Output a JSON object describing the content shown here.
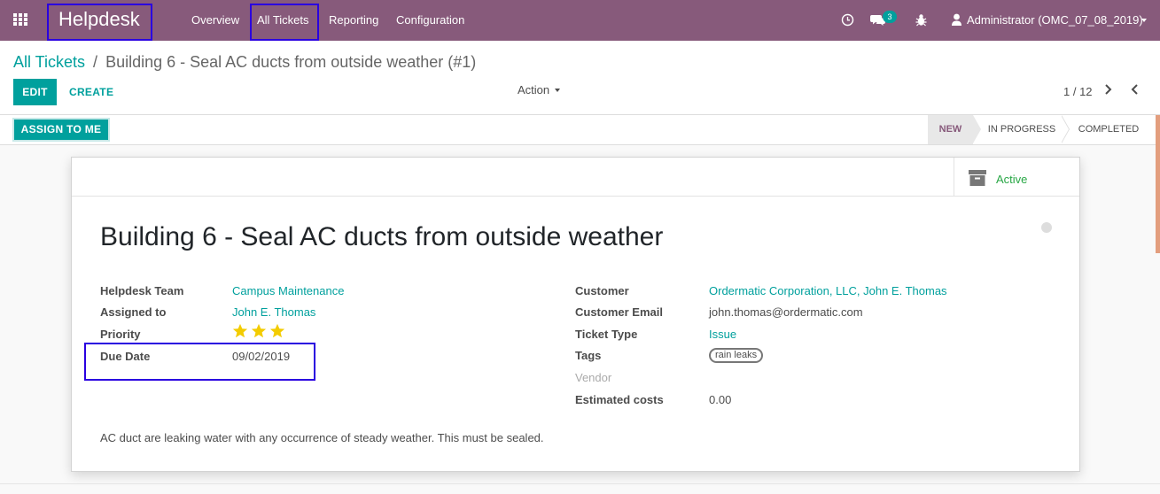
{
  "navbar": {
    "brand": "Helpdesk",
    "menu": [
      "Overview",
      "All Tickets",
      "Reporting",
      "Configuration"
    ],
    "messages_count": "3",
    "user": "Administrator (OMC_07_08_2019)",
    "icons": [
      "apps-grid-icon",
      "clock-icon",
      "chat-icon",
      "bug-icon",
      "user-icon",
      "caret-down-icon"
    ]
  },
  "control_panel": {
    "breadcrumb_parent": "All Tickets",
    "breadcrumb_separator": "/",
    "breadcrumb_current": "Building 6 - Seal AC ducts from outside weather (#1)",
    "edit_label": "EDIT",
    "create_label": "CREATE",
    "action_label": "Action",
    "pager": "1 / 12"
  },
  "statusbar": {
    "assign_label": "ASSIGN TO ME",
    "stages": [
      "NEW",
      "IN PROGRESS",
      "COMPLETED"
    ],
    "current_stage": "NEW"
  },
  "sheet": {
    "active_label": "Active",
    "title": "Building 6 - Seal AC ducts from outside weather",
    "left_fields": [
      {
        "label": "Helpdesk Team",
        "value": "Campus Maintenance",
        "is_link": true
      },
      {
        "label": "Assigned to",
        "value": "John E. Thomas",
        "is_link": true
      },
      {
        "label": "Priority",
        "value": "",
        "stars": 3
      },
      {
        "label": "Due Date",
        "value": "09/02/2019"
      }
    ],
    "right_fields": [
      {
        "label": "Customer",
        "value": "Ordermatic Corporation, LLC, John E. Thomas",
        "is_link": true
      },
      {
        "label": "Customer Email",
        "value": "john.thomas@ordermatic.com"
      },
      {
        "label": "Ticket Type",
        "value": "Issue",
        "is_link": true
      },
      {
        "label": "Tags",
        "value": "rain leaks"
      },
      {
        "label": "Vendor",
        "value": ""
      },
      {
        "label": "Estimated costs",
        "value": "0.00"
      }
    ],
    "description": "AC duct are leaking water with any occurrence of steady weather.  This must be sealed."
  },
  "colors": {
    "navbar": "#875a7b",
    "accent": "#00a09d",
    "highlight_box": "#2a00e0",
    "star": "#f3cc00",
    "active_green": "#28a745"
  }
}
